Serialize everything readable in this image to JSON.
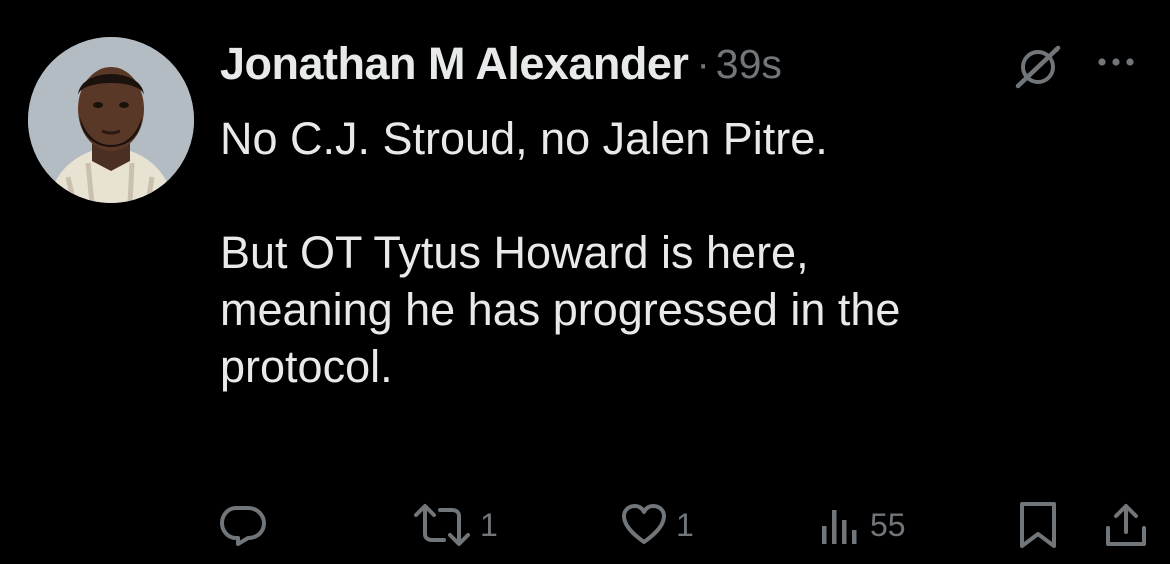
{
  "tweet": {
    "author": {
      "display_name": "Jonathan M Alexander",
      "avatar_icon": "user-avatar"
    },
    "separator": "·",
    "timestamp": "39s",
    "text_lines": [
      "No C.J. Stroud, no Jalen Pitre.",
      "But OT Tytus Howard is here,",
      "meaning he has progressed in the",
      "protocol."
    ],
    "header_icons": [
      "grok-icon",
      "more-icon"
    ],
    "actions": {
      "reply": {
        "icon": "reply-icon",
        "count": ""
      },
      "retweet": {
        "icon": "retweet-icon",
        "count": "1"
      },
      "like": {
        "icon": "heart-icon",
        "count": "1"
      },
      "views": {
        "icon": "views-icon",
        "count": "55"
      },
      "bookmark": {
        "icon": "bookmark-icon"
      },
      "share": {
        "icon": "share-icon"
      }
    },
    "colors": {
      "background": "#000000",
      "primary_text": "#e7e9ea",
      "secondary_text": "#71767b"
    }
  }
}
